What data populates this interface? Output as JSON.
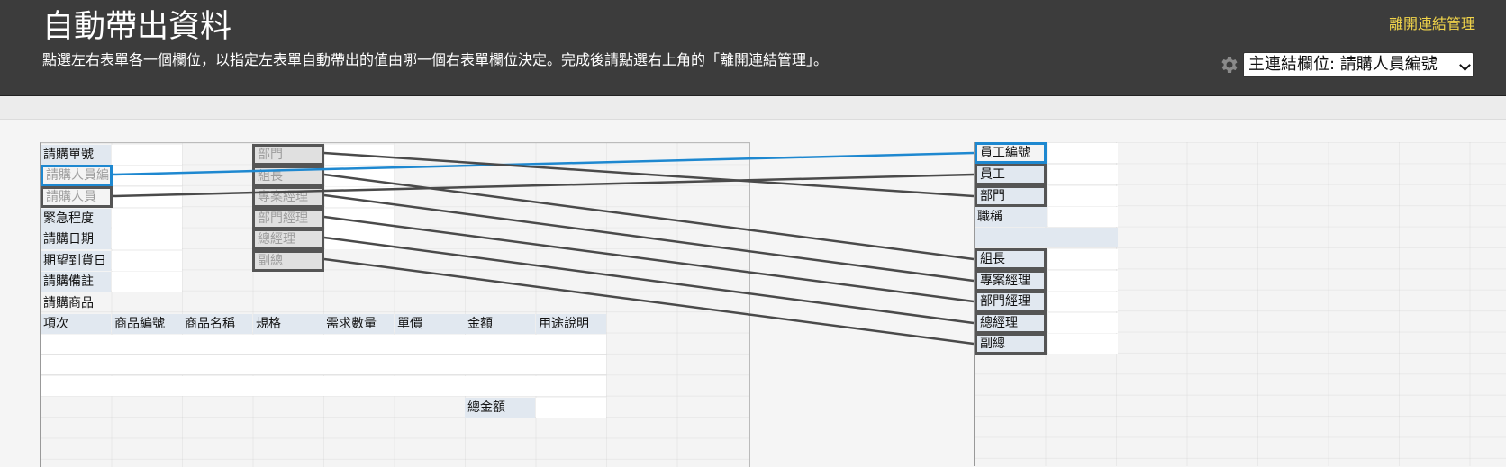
{
  "header": {
    "title": "自動帶出資料",
    "description": "點選左右表單各一個欄位，以指定左表單自動帶出的值由哪一個右表單欄位決定。完成後請點選右上角的「離開連結管理」。",
    "leave_link": "離開連結管理",
    "main_link_field": "主連結欄位: 請購人員編號",
    "settings_icon": "gear-icon"
  },
  "left_form": {
    "fields": [
      "請購單號",
      "請購人員編",
      "請購人員",
      "緊急程度",
      "請購日期",
      "期望到貨日",
      "請購備註",
      "請購商品"
    ],
    "linked_fields": [
      "部門",
      "組長",
      "專案經理",
      "部門經理",
      "總經理",
      "副總"
    ],
    "table_headers": [
      "項次",
      "商品編號",
      "商品名稱",
      "規格",
      "需求數量",
      "單價",
      "金額",
      "用途說明"
    ],
    "total_label": "總金額"
  },
  "right_form": {
    "fields": [
      "員工編號",
      "員工",
      "部門",
      "職稱",
      "組長",
      "專案經理",
      "部門經理",
      "總經理",
      "副總"
    ]
  },
  "colors": {
    "header_bg": "#3c3c3c",
    "link_color": "#f1d44a",
    "active_link": "#1e88d0",
    "link_line": "#4a4a4a"
  }
}
